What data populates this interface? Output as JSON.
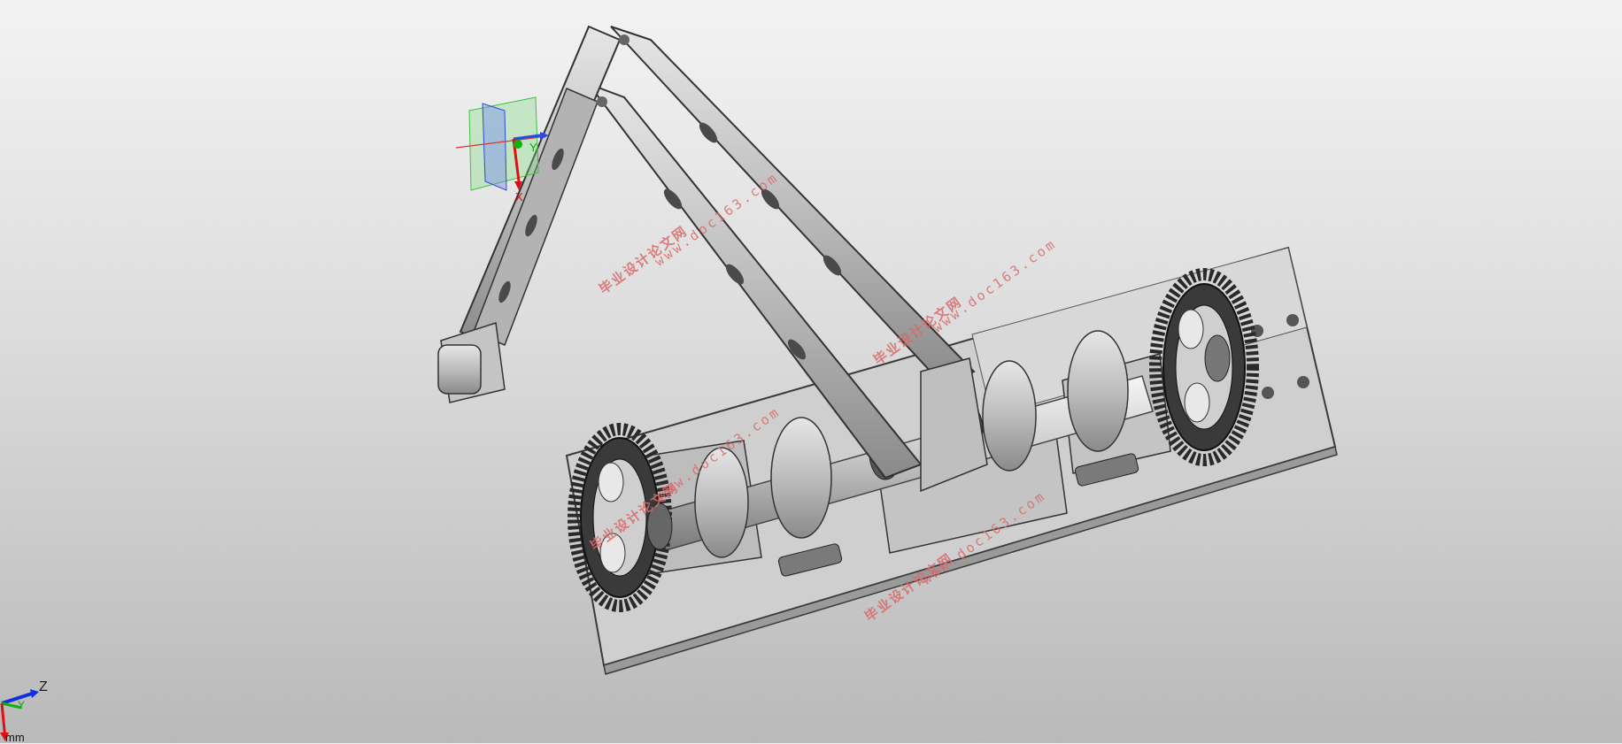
{
  "viewport": {
    "units": "mm",
    "triad_axes": {
      "x": "X",
      "y": "Y",
      "z": "Z"
    },
    "colors": {
      "x_axis": "#e01010",
      "y_axis": "#10b010",
      "z_axis": "#1030e0",
      "part_fill": "#c8c8c8",
      "gear_fill": "#3a3a3a"
    }
  },
  "model_triad": {
    "y_label": "Y",
    "x_label": "X"
  },
  "watermarks": [
    {
      "text": "毕业设计论文网"
    },
    {
      "text": "www.doc163.com"
    },
    {
      "text": "毕业设计论文网"
    },
    {
      "text": "www.doc163.com"
    },
    {
      "text": "毕业设计论文网"
    },
    {
      "text": "www.doc163.com"
    },
    {
      "text": "毕业设计论文网"
    },
    {
      "text": "www.doc163.com"
    }
  ],
  "icons": [
    "view-triad-icon",
    "model-origin-triad-icon"
  ]
}
